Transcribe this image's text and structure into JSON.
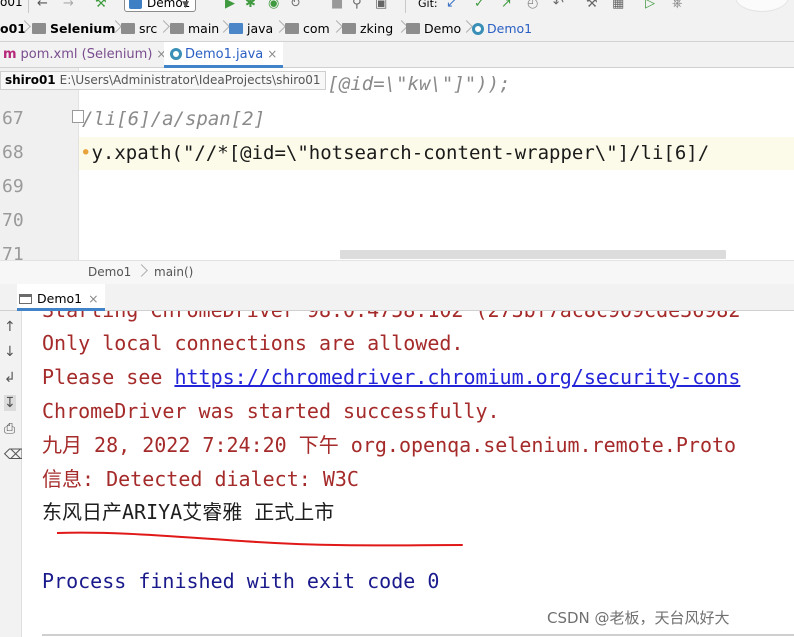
{
  "toolbar": {
    "left_fragment": "o01",
    "run_config": "Demo1",
    "git_label": "Git:"
  },
  "navbar": {
    "crumbs": [
      "o01",
      "Selenium",
      "src",
      "main",
      "java",
      "com",
      "zking",
      "Demo",
      "Demo1"
    ]
  },
  "tabs": [
    {
      "label": "pom.xml (Selenium)",
      "active": false
    },
    {
      "label": "Demo1.java",
      "active": true
    }
  ],
  "tooltip": {
    "project": "shiro01",
    "path": "E:\\Users\\Administrator\\IdeaProjects\\shiro01"
  },
  "editor": {
    "lines": [
      {
        "num": "",
        "text": "*[@id=\\\"kw\\\"]\"));"
      },
      {
        "num": "67",
        "text": "/li[6]/a/span[2]"
      },
      {
        "num": "68",
        "text": "y.xpath(\"//*[@id=\\\"hotsearch-content-wrapper\\\"]/li[6]/"
      },
      {
        "num": "69",
        "text": ""
      },
      {
        "num": "70",
        "text": ""
      },
      {
        "num": "71",
        "text": ""
      }
    ]
  },
  "editor_breadcrumb": {
    "class_name": "Demo1",
    "method_name": "main()"
  },
  "run_panel": {
    "tab_label": "Demo1"
  },
  "console": {
    "partial_top": "Starting ChromeDriver 98.0.4758.102 (273bf7ac8c909cde36982",
    "lines": [
      "Only local connections are allowed.",
      "Please see ",
      "ChromeDriver was started successfully.",
      "九月 28, 2022 7:24:20 下午 org.openqa.selenium.remote.Proto",
      "信息: Detected dialect: W3C",
      "东风日产ARIYA艾睿雅 正式上市",
      "Process finished with exit code 0"
    ],
    "link_text": "https://chromedriver.chromium.org/security-cons"
  },
  "watermark": "CSDN @老板，天台风好大",
  "colors": {
    "console_red": "#a52a2a",
    "link_blue": "#2424d8",
    "process_blue": "#1a1a8c",
    "annotation_red": "#e01818",
    "tab_accent": "#4083c9"
  }
}
